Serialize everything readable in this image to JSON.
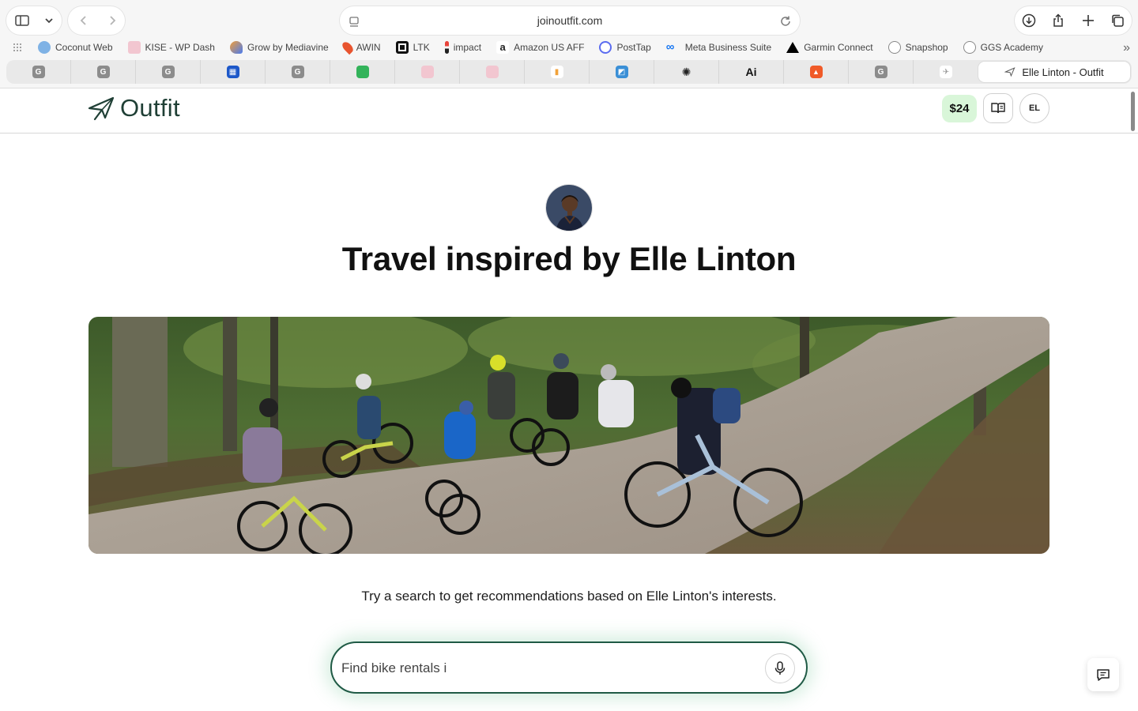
{
  "browser": {
    "url": "joinoutfit.com",
    "bookmarks": [
      {
        "label": "Coconut Web",
        "color": "#7fb2e5"
      },
      {
        "label": "KISE - WP Dash",
        "color": "#f2c6d0"
      },
      {
        "label": "Grow by Mediavine",
        "color": "#f29d38"
      },
      {
        "label": "AWIN",
        "color": "#e8542f"
      },
      {
        "label": "LTK",
        "color": "#111111"
      },
      {
        "label": "impact",
        "color": "#e8433a"
      },
      {
        "label": "Amazon US AFF",
        "color": "#222222"
      },
      {
        "label": "PostTap",
        "color": "#5b6cf0"
      },
      {
        "label": "Meta Business Suite",
        "color": "#1877f2"
      },
      {
        "label": "Garmin Connect",
        "color": "#000000"
      },
      {
        "label": "Snapshop",
        "color": "#888888"
      },
      {
        "label": "GGS Academy",
        "color": "#888888"
      }
    ],
    "tabs": [
      {
        "glyph": "G",
        "color": "#8c8c8c"
      },
      {
        "glyph": "G",
        "color": "#8c8c8c"
      },
      {
        "glyph": "G",
        "color": "#8c8c8c"
      },
      {
        "glyph": "▦",
        "color": "#1d58c9"
      },
      {
        "glyph": "G",
        "color": "#8c8c8c"
      },
      {
        "glyph": "▬",
        "color": "#33b35a"
      },
      {
        "glyph": "",
        "color": "#f2c6d0"
      },
      {
        "glyph": "",
        "color": "#f2c6d0"
      },
      {
        "glyph": "▮",
        "color": "#f2a23a"
      },
      {
        "glyph": "◩",
        "color": "#3a8fd6"
      },
      {
        "glyph": "✺",
        "color": "#222222"
      },
      {
        "glyph": "Ai",
        "color": "#111111"
      },
      {
        "glyph": "▲",
        "color": "#f05a28"
      },
      {
        "glyph": "G",
        "color": "#8c8c8c"
      },
      {
        "glyph": "✈",
        "color": "#dddddd"
      }
    ],
    "active_tab_title": "Elle Linton - Outfit"
  },
  "site": {
    "logo_text": "Outfit",
    "credits": "$24",
    "user_initials": "EL",
    "brand_color": "#1f3f35"
  },
  "main": {
    "headline": "Travel inspired by Elle Linton",
    "subtitle": "Try a search to get recommendations based on Elle Linton's interests.",
    "search": {
      "value": "Find bike rentals i",
      "placeholder": "Find bike rentals i"
    }
  }
}
